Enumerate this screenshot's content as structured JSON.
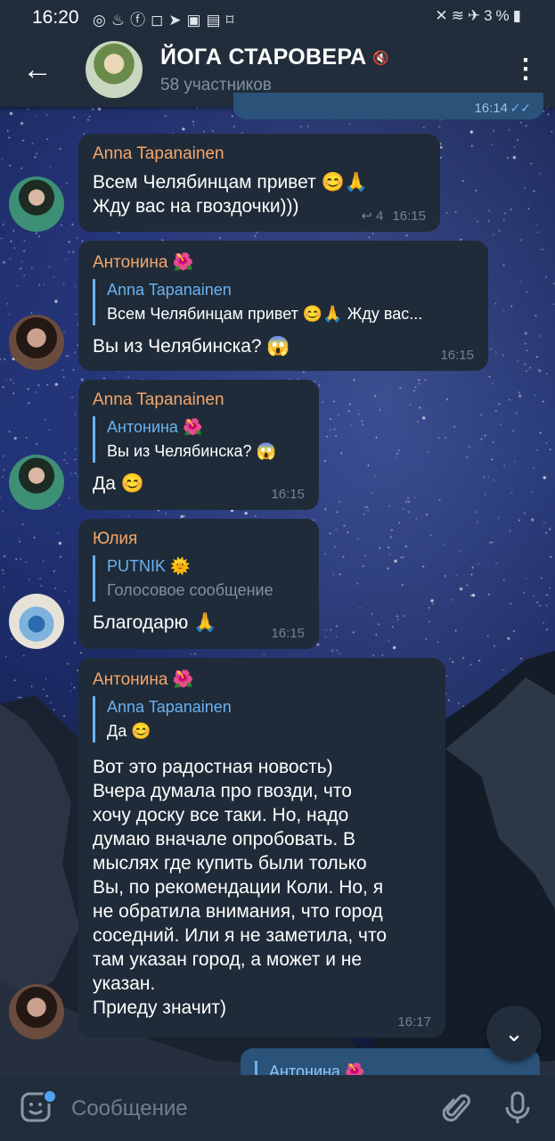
{
  "status_bar": {
    "time": "16:20",
    "battery": "3%",
    "left_icons": [
      "whatsapp-icon",
      "flame-icon",
      "facebook-icon",
      "instagram-icon",
      "telegram-icon",
      "translate-icon",
      "gallery-icon",
      "screenshot-icon"
    ],
    "right_icons": [
      "mute-icon",
      "wifi-icon",
      "airplane-icon",
      "battery-icon"
    ]
  },
  "header": {
    "title": "ЙОГА СТАРОВЕРА",
    "subtitle": "58 участников",
    "back_icon": "arrow-left-icon",
    "menu_icon": "more-vertical-icon",
    "mute_icon": "muted-speaker-icon"
  },
  "messages": [
    {
      "sender": "Anna Tapanainen",
      "sender_color": "#f5a66b",
      "text_line1": "Всем Челябинцам привет 😊🙏",
      "text_line2": "Жду вас на гвоздочки)))",
      "forwards": "4",
      "time": "16:15"
    },
    {
      "sender": "Антонина 🌺",
      "sender_color": "#f5a66b",
      "reply_name": "Anna Tapanainen",
      "reply_text": "Всем Челябинцам привет 😊🙏 Жду вас...",
      "text": "Вы из Челябинска? 😱",
      "time": "16:15"
    },
    {
      "sender": "Anna Tapanainen",
      "sender_color": "#f5a66b",
      "reply_name": "Антонина 🌺",
      "reply_text": "Вы из Челябинска? 😱",
      "text": "Да 😊",
      "time": "16:15"
    },
    {
      "sender": "Юлия",
      "sender_color": "#f5a66b",
      "reply_name": "PUTNIK 🌞",
      "reply_text": "Голосовое сообщение",
      "text": "Благодарю 🙏",
      "time": "16:15"
    },
    {
      "sender": "Антонина 🌺",
      "sender_color": "#f5a66b",
      "reply_name": "Anna Tapanainen",
      "reply_text": "Да 😊",
      "lines": [
        "Вот это радостная новость)",
        "Вчера думала про гвозди, что",
        "хочу доску все таки. Но, надо",
        "думаю вначале опробовать. В",
        "мыслях где купить были только",
        "Вы, по рекомендации Коли. Но, я",
        "не обратила внимания, что город",
        "соседний. Или я не заметила, что",
        "там указан город, а может и не",
        "указан.",
        "Приеду значит)"
      ],
      "time": "16:17"
    }
  ],
  "top_partial": {
    "time": "16:14"
  },
  "bottom_partial": {
    "reply_name": "Антонина 🌺"
  },
  "composer": {
    "placeholder": "Сообщение",
    "emoji_icon": "sticker-emoji-icon",
    "attach_icon": "paperclip-icon",
    "mic_icon": "microphone-icon"
  },
  "scroll_icon": "chevron-down-icon"
}
